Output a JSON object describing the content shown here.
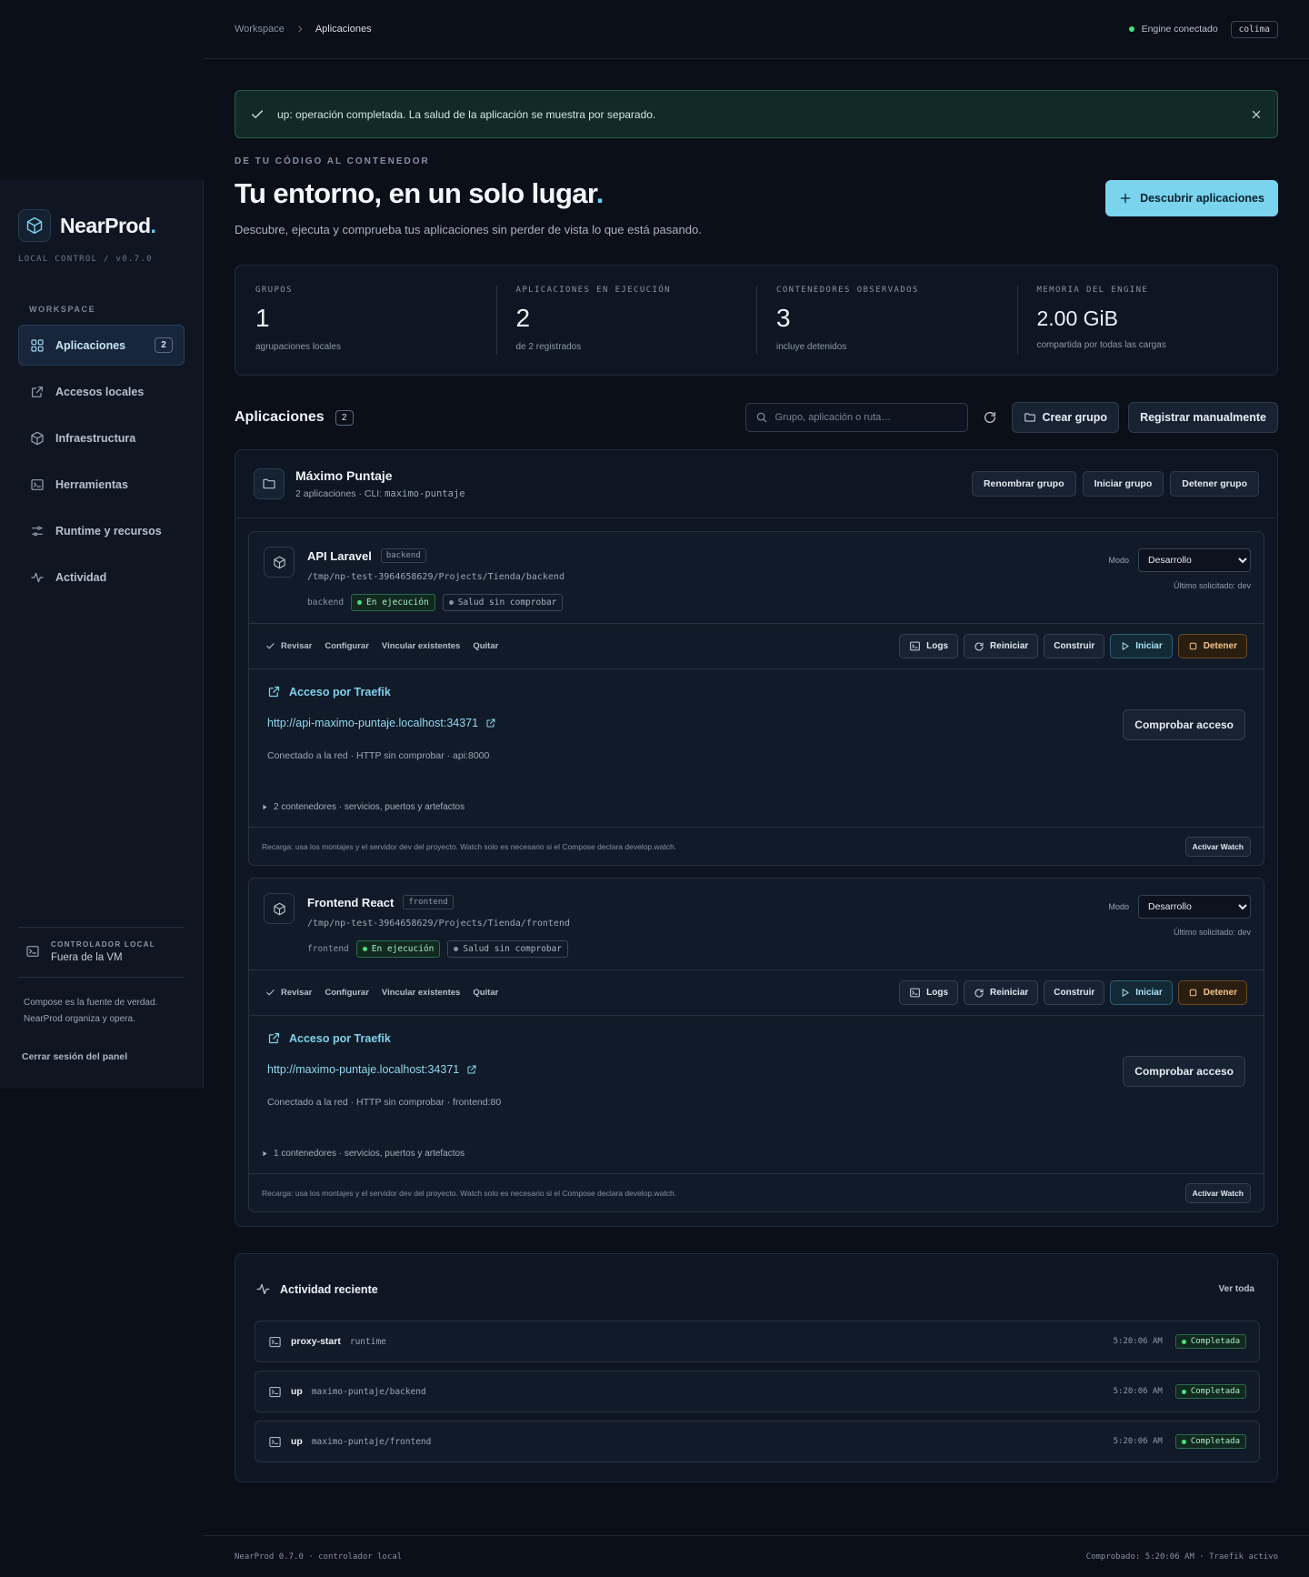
{
  "sidebar": {
    "brand": "NearProd",
    "version": "LOCAL CONTROL / v0.7.0",
    "section": "WORKSPACE",
    "items": [
      {
        "label": "Aplicaciones",
        "badge": "2"
      },
      {
        "label": "Accesos locales"
      },
      {
        "label": "Infraestructura"
      },
      {
        "label": "Herramientas"
      },
      {
        "label": "Runtime y recursos"
      },
      {
        "label": "Actividad"
      }
    ],
    "controller_label": "CONTROLADOR LOCAL",
    "controller_value": "Fuera de la VM",
    "note": "Compose es la fuente de verdad. NearProd organiza y opera.",
    "logout": "Cerrar sesión del panel"
  },
  "topbar": {
    "crumb_root": "Workspace",
    "crumb_current": "Aplicaciones",
    "engine_status": "Engine conectado",
    "engine_name": "colima"
  },
  "alert": {
    "message": "up: operación completada. La salud de la aplicación se muestra por separado."
  },
  "hero": {
    "eyebrow": "DE TU CÓDIGO AL CONTENEDOR",
    "title": "Tu entorno, en un solo lugar",
    "subtitle": "Descubre, ejecuta y comprueba tus aplicaciones sin perder de vista lo que está pasando.",
    "discover_label": "Descubrir aplicaciones"
  },
  "stats": [
    {
      "label": "GRUPOS",
      "value": "1",
      "foot": "agrupaciones locales"
    },
    {
      "label": "APLICACIONES EN EJECUCIÓN",
      "value": "2",
      "foot": "de 2 registrados"
    },
    {
      "label": "CONTENEDORES OBSERVADOS",
      "value": "3",
      "foot": "incluye detenidos"
    },
    {
      "label": "MEMORIA DEL ENGINE",
      "value": "2.00 GiB",
      "foot": "compartida por todas las cargas"
    }
  ],
  "apps_section": {
    "title": "Aplicaciones",
    "count": "2",
    "search_placeholder": "Grupo, aplicación o ruta…",
    "create_group": "Crear grupo",
    "register": "Registrar manualmente"
  },
  "group": {
    "name": "Máximo Puntaje",
    "meta": "2 aplicaciones · CLI:",
    "cli": "maximo-puntaje",
    "rename": "Renombrar grupo",
    "start": "Iniciar grupo",
    "stop": "Detener grupo"
  },
  "app_labels": {
    "mode_label": "Modo",
    "review": "Revisar",
    "configure": "Configurar",
    "link": "Vincular existentes",
    "remove": "Quitar",
    "logs": "Logs",
    "restart": "Reiniciar",
    "build": "Construir",
    "start": "Iniciar",
    "stop": "Detener",
    "access_title": "Acceso por Traefik",
    "check_access": "Comprobar acceso",
    "footer_note": "Recarga: usa los montajes y el servidor dev del proyecto. Watch solo es necesario si el Compose declara develop.watch.",
    "watch": "Activar Watch"
  },
  "apps": [
    {
      "name": "API Laravel",
      "tag": "backend",
      "path": "/tmp/np-test-3964658629/Projects/Tienda/backend",
      "service": "backend",
      "status": "En ejecución",
      "health": "Salud sin comprobar",
      "mode": "Desarrollo",
      "last": "Último solicitado: dev",
      "url": "http://api-maximo-puntaje.localhost:34371",
      "info": "Conectado a la red · HTTP sin comprobar · api:8000",
      "containers": "2 contenedores · servicios, puertos y artefactos"
    },
    {
      "name": "Frontend React",
      "tag": "frontend",
      "path": "/tmp/np-test-3964658629/Projects/Tienda/frontend",
      "service": "frontend",
      "status": "En ejecución",
      "health": "Salud sin comprobar",
      "mode": "Desarrollo",
      "last": "Último solicitado: dev",
      "url": "http://maximo-puntaje.localhost:34371",
      "info": "Conectado a la red · HTTP sin comprobar · frontend:80",
      "containers": "1 contenedores · servicios, puertos y artefactos"
    }
  ],
  "activity": {
    "title": "Actividad reciente",
    "see_all": "Ver toda",
    "rows": [
      {
        "name": "proxy-start",
        "target": "runtime",
        "time": "5:20:06 AM",
        "status": "Completada"
      },
      {
        "name": "up",
        "target": "maximo-puntaje/backend",
        "time": "5:20:06 AM",
        "status": "Completada"
      },
      {
        "name": "up",
        "target": "maximo-puntaje/frontend",
        "time": "5:20:06 AM",
        "status": "Completada"
      }
    ]
  },
  "footer": {
    "left": "NearProd 0.7.0 · controlador local",
    "right": "Comprobado: 5:20:06 AM · Traefik activo"
  },
  "colors": {
    "accent": "#7bd4ee",
    "success": "#4ade80",
    "warning": "#f2c48a",
    "background": "#0a0f18"
  }
}
